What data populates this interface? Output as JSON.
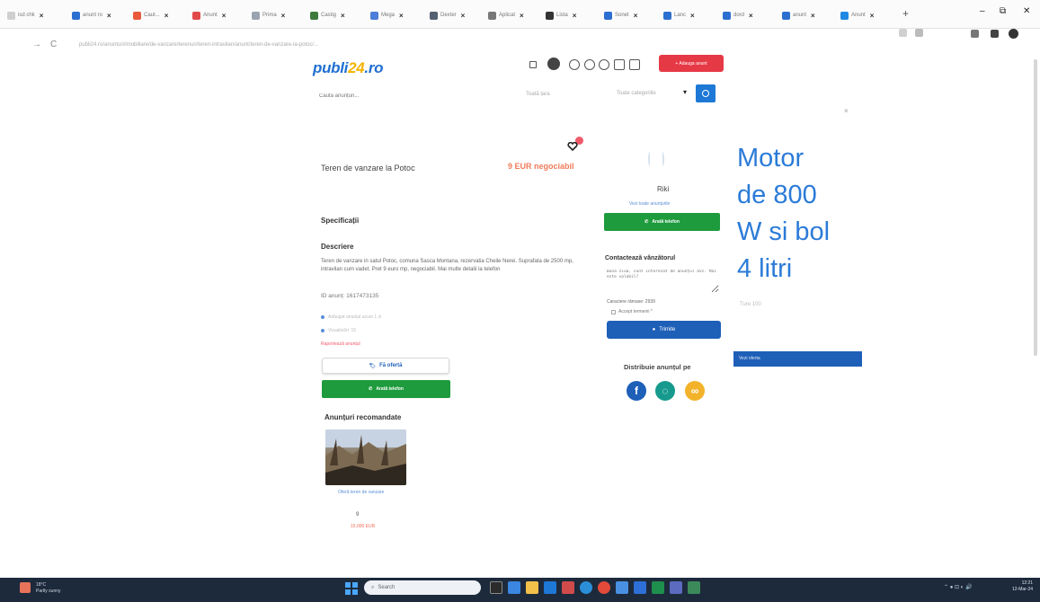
{
  "browser": {
    "tabs": [
      {
        "label": "isd chk",
        "color": "#cfcfcf"
      },
      {
        "label": "anunt ro",
        "color": "#2b6fd1"
      },
      {
        "label": "Caut...",
        "color": "#e85a3a"
      },
      {
        "label": "Anunt",
        "color": "#e24a4a"
      },
      {
        "label": "Prima",
        "color": "#9aa4b0"
      },
      {
        "label": "Castig",
        "color": "#3d7a3d"
      },
      {
        "label": "Mega",
        "color": "#4a7ed8"
      },
      {
        "label": "Dexter",
        "color": "#556070"
      },
      {
        "label": "Aplicat",
        "color": "#777777"
      },
      {
        "label": "Lista",
        "color": "#333333"
      },
      {
        "label": "Sonet",
        "color": "#2b6fd1"
      },
      {
        "label": "Lanc",
        "color": "#2b6fd1"
      },
      {
        "label": "dord",
        "color": "#2b6fd1"
      },
      {
        "label": "anunt",
        "color": "#2b6fd1"
      },
      {
        "label": "Anunt",
        "color": "#1e88e5"
      }
    ],
    "new_tab": "+",
    "window_controls": {
      "minimize": "–",
      "restore": "⧉",
      "close": "✕"
    },
    "nav": {
      "back": "←",
      "forward": "→",
      "reload": "C"
    },
    "url": "publi24.ro/anunturi/imobiliare/de-vanzare/terenuri/teren-intravilan/anunt/teren-de-vanzare-la-potoc/..."
  },
  "site": {
    "logo_main": "publi",
    "logo_accent": "24",
    "logo_tld": ".ro",
    "add_ad_label": "+ Adauga anunt",
    "search": {
      "placeholder": "Caută anunțuri...",
      "location": "Toată țara",
      "category": "Toate categoriile"
    }
  },
  "listing": {
    "title": "Teren de vanzare la Potoc",
    "price": "9 EUR negociabil",
    "specs_heading": "Specificații",
    "description_heading": "Descriere",
    "description": "Teren de vanzare in satul Potoc, comuna Sasca Montana, rezervatia Cheile Nerei. Suprafata de 2500 mp, intravilan cum vadet. Pret 9 euro mp, negociabil. Mai multe detalii la telefon",
    "ad_id": "ID anunț: 1617473135",
    "meta1": "Adăugat anunțul acum 1 zi",
    "meta2": "Vizualizări: 15",
    "report": "Raportează anunțul",
    "fav_button": "Fă ofertă",
    "call_button": "Arată telefon"
  },
  "recommended": {
    "heading": "Anunțuri recomandate",
    "caption": "Oferă teren de vanzare",
    "mid": "9",
    "price": "15,000 EUR"
  },
  "seller": {
    "name": "Riki",
    "link": "Vezi toate anunțurile",
    "call_button": "Arată telefon",
    "contact_heading": "Contactează vânzătorul",
    "message_placeholder": "Bună ziua, sunt interesat de anunțul dvs. Mai este valabil?",
    "char_count": "Caractere rămase: 2939",
    "accept_terms": "Accept termenii *",
    "send_button": "Trimite",
    "share_heading": "Distribuie anunțul pe"
  },
  "overlay_note": [
    "Motor",
    "de 800",
    "W si bol",
    "4 litri"
  ],
  "faint": {
    "side_text": "Ture 100",
    "side_button": "Vezi oferta"
  },
  "taskbar": {
    "weather_temp": "18°C",
    "weather_desc": "Partly sunny",
    "search_label": "Search",
    "clock_time": "12:21",
    "clock_date": "12-Mar-24"
  },
  "colors": {
    "brand_blue": "#1f6fd2",
    "call_green": "#1e9b3d",
    "price_orange": "#f07b5a",
    "note_blue": "#2b7bd8"
  }
}
